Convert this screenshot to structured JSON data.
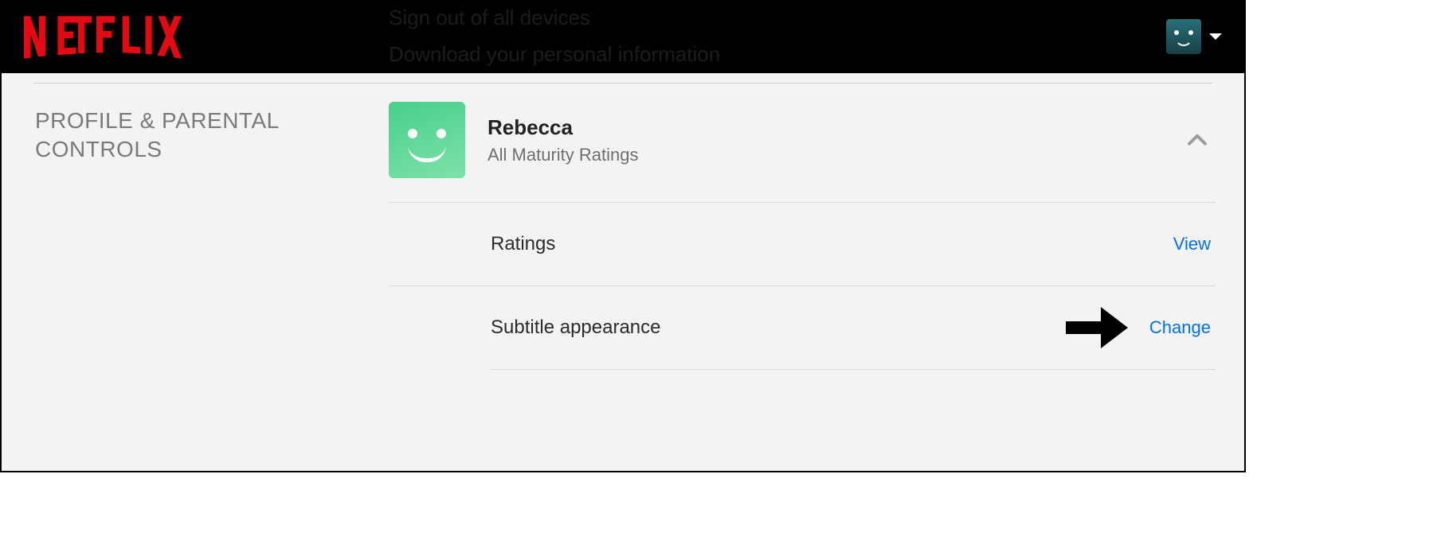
{
  "header": {
    "brand": "NETFLIX",
    "faded_links": {
      "line1": "Sign out of all devices",
      "line2": "Download your personal information"
    }
  },
  "section": {
    "title": "PROFILE & PARENTAL CONTROLS"
  },
  "profile": {
    "name": "Rebecca",
    "maturity": "All Maturity Ratings"
  },
  "settings": [
    {
      "label": "Ratings",
      "action": "View"
    },
    {
      "label": "Subtitle appearance",
      "action": "Change"
    }
  ]
}
